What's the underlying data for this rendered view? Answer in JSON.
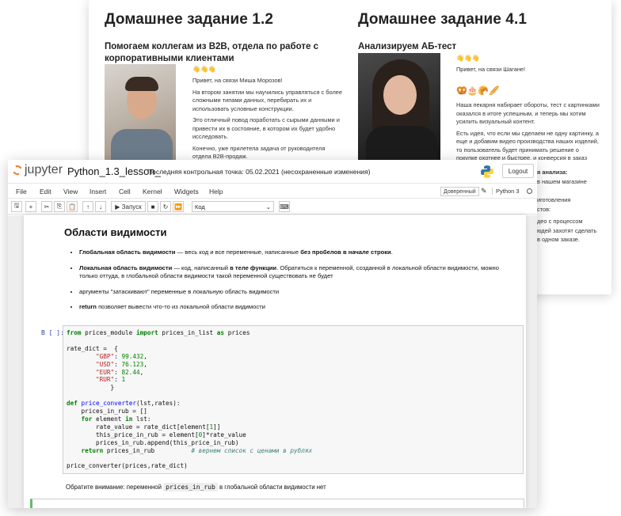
{
  "homework_left": {
    "title": "Домашнее задание 1.2",
    "subtitle": "Помогаем коллегам из B2B, отдела по работе с корпоративными клиентами",
    "emoji": "👋👋👋",
    "paragraphs": [
      "Привет, на связи Миша Морозов!",
      "На втором занятии мы научились управляться с более сложными типами данных, перебирать их и использовать условные конструкции.",
      "Это отличный повод поработать с сырыми данными и привести их в состояние, в котором их будет удобно исследовать.",
      "Конечно, уже прилетела задача от руководителя отдела B2B-продаж."
    ]
  },
  "homework_right": {
    "title": "Домашнее задание 4.1",
    "subtitle": "Анализируем АБ-тест",
    "emoji": "👋👋👋",
    "greeting": "Привет, на связи Шагане!",
    "emoji2": "🥨🎂🥐🥖",
    "paragraphs": [
      "Наша пекарня набирает обороты, тест с картинками оказался в итоге успешным, и теперь мы хотим усилить визуальный контент.",
      "Есть идея, что если мы сделаем не одну картинку, а еще и добавим видео производства наших изделий, то пользователь будет принимать решение о покупке охотнее и быстрее, и конверсия в заказ вырастет."
    ],
    "peek_lines": [
      "я анализа:",
      "в нашем магазине",
      "иготовления",
      "стов:",
      "део с процессом",
      "юдей захотят сделать",
      "в одном заказе."
    ]
  },
  "jupyter": {
    "logo_text": "jupyter",
    "notebook_name": "Python_1.3_lesson_",
    "checkpoint": "Последняя контрольная точка: 05.02.2021   (несохраненные изменения)",
    "logout": "Logout",
    "menu": [
      "File",
      "Edit",
      "View",
      "Insert",
      "Cell",
      "Kernel",
      "Widgets",
      "Help"
    ],
    "trusted": "Доверенный",
    "kernel": "Python 3",
    "run_label": "▶ Запуск",
    "cell_type": "Код",
    "md_title": "Области видимости",
    "bullets": [
      {
        "bold": "Глобальная область видимости",
        "text": " — весь код и все переменные, написанные ",
        "bold2": "без пробелов в начале строки",
        "tail": "."
      },
      {
        "bold": "Локальная область видимости",
        "text": " — код, написанный ",
        "bold2": "в теле функции",
        "tail": ". Обратиться к переменной, созданной в локальной области видимости, можно только оттуда, в глобальной области видимости такой переменной существовать не будет"
      },
      {
        "bold": "",
        "text": "аргументы \"затаскивают\" переменные в локальную область видимости",
        "bold2": "",
        "tail": ""
      },
      {
        "bold": "return",
        "text": " позволяет вывести что-то из локальной области видимости",
        "bold2": "",
        "tail": ""
      }
    ],
    "prompt": "В [ ]:",
    "note_before": "Обратите внимание: переменной ",
    "note_code": "prices_in_rub",
    "note_after": " в глобальной области видимости нет"
  }
}
